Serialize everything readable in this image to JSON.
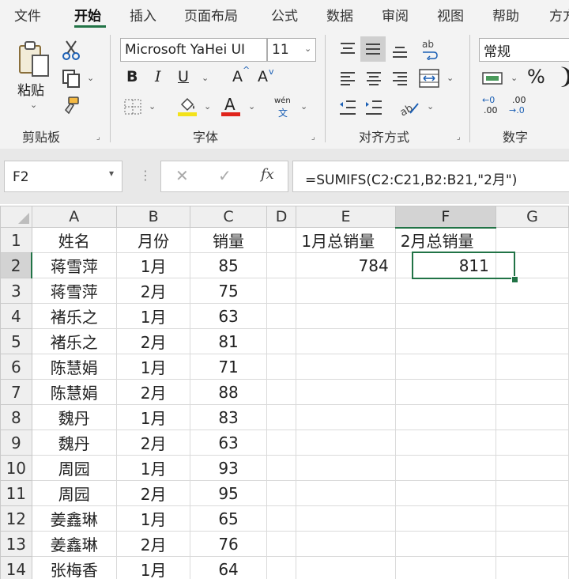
{
  "menu": {
    "tabs": [
      "文件",
      "开始",
      "插入",
      "页面布局",
      "公式",
      "数据",
      "审阅",
      "视图",
      "帮助",
      "方方"
    ],
    "active": "开始"
  },
  "ribbon": {
    "clipboard": {
      "paste_label": "粘贴",
      "group_label": "剪贴板"
    },
    "font": {
      "font_name": "Microsoft YaHei UI",
      "font_size": "11",
      "bold": "B",
      "italic": "I",
      "underline": "U",
      "grow": "A",
      "shrink": "A",
      "phonetic_top": "wén",
      "phonetic_bottom": "文",
      "font_color_glyph": "A",
      "group_label": "字体",
      "fill_color": "#f3e21a",
      "font_color": "#e0241b"
    },
    "alignment": {
      "group_label": "对齐方式",
      "wrap_glyph": "ab"
    },
    "number": {
      "format": "常规",
      "percent": "%",
      "group_label": "数字",
      "inc_top": "←0",
      "inc_bottom": ".00",
      "dec_top": ".00",
      "dec_bottom": "→.0"
    }
  },
  "formula_bar": {
    "name_box": "F2",
    "formula": "=SUMIFS(C2:C21,B2:B21,\"2月\")",
    "fx": "fx"
  },
  "sheet": {
    "columns": [
      "A",
      "B",
      "C",
      "D",
      "E",
      "F",
      "G"
    ],
    "rows": [
      {
        "n": "1",
        "A": "姓名",
        "B": "月份",
        "C": "销量",
        "D": "",
        "E": "1月总销量",
        "F": "2月总销量"
      },
      {
        "n": "2",
        "A": "蒋雪萍",
        "B": "1月",
        "C": "85",
        "D": "",
        "E": "784",
        "F": "811"
      },
      {
        "n": "3",
        "A": "蒋雪萍",
        "B": "2月",
        "C": "75",
        "D": "",
        "E": "",
        "F": ""
      },
      {
        "n": "4",
        "A": "褚乐之",
        "B": "1月",
        "C": "63",
        "D": "",
        "E": "",
        "F": ""
      },
      {
        "n": "5",
        "A": "褚乐之",
        "B": "2月",
        "C": "81",
        "D": "",
        "E": "",
        "F": ""
      },
      {
        "n": "6",
        "A": "陈慧娟",
        "B": "1月",
        "C": "71",
        "D": "",
        "E": "",
        "F": ""
      },
      {
        "n": "7",
        "A": "陈慧娟",
        "B": "2月",
        "C": "88",
        "D": "",
        "E": "",
        "F": ""
      },
      {
        "n": "8",
        "A": "魏丹",
        "B": "1月",
        "C": "83",
        "D": "",
        "E": "",
        "F": ""
      },
      {
        "n": "9",
        "A": "魏丹",
        "B": "2月",
        "C": "63",
        "D": "",
        "E": "",
        "F": ""
      },
      {
        "n": "10",
        "A": "周园",
        "B": "1月",
        "C": "93",
        "D": "",
        "E": "",
        "F": ""
      },
      {
        "n": "11",
        "A": "周园",
        "B": "2月",
        "C": "95",
        "D": "",
        "E": "",
        "F": ""
      },
      {
        "n": "12",
        "A": "姜鑫琳",
        "B": "1月",
        "C": "65",
        "D": "",
        "E": "",
        "F": ""
      },
      {
        "n": "13",
        "A": "姜鑫琳",
        "B": "2月",
        "C": "76",
        "D": "",
        "E": "",
        "F": ""
      },
      {
        "n": "14",
        "A": "张梅香",
        "B": "1月",
        "C": "64",
        "D": "",
        "E": "",
        "F": ""
      }
    ],
    "selected_cell": "F2",
    "accent": "#217346"
  }
}
